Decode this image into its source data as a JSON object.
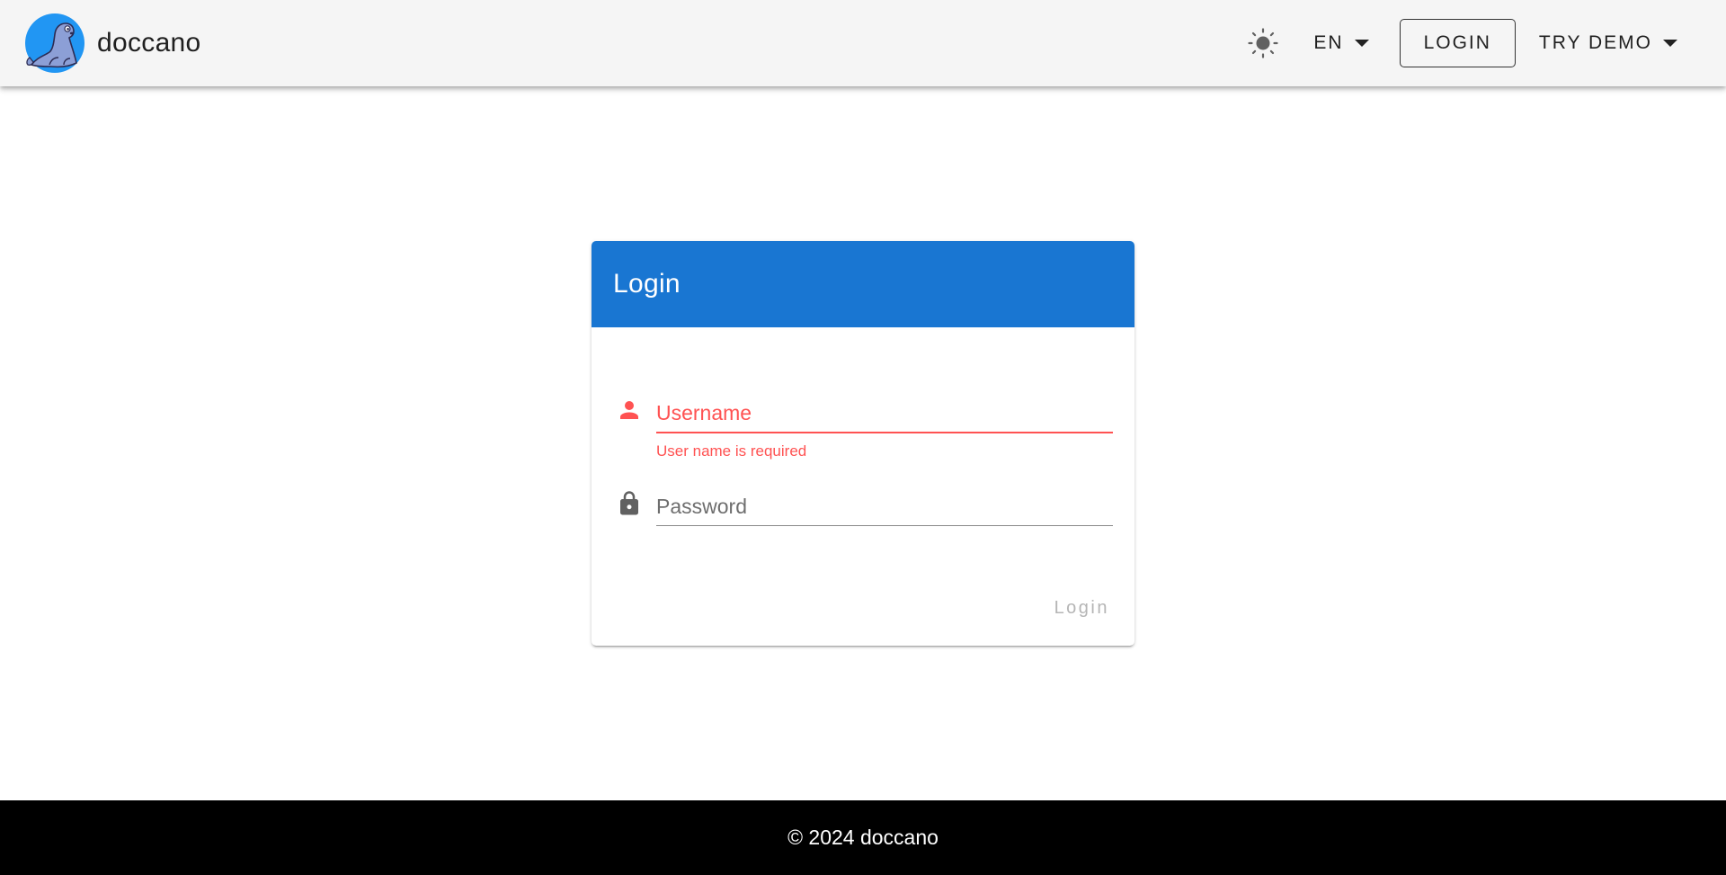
{
  "app": {
    "name": "doccano",
    "logo_icon": "seal-logo-icon",
    "accent_color": "#1976d2"
  },
  "toolbar": {
    "theme_icon": "sun-brightness-icon",
    "language_label": "EN",
    "login_label": "LOGIN",
    "demo_label": "TRY DEMO"
  },
  "login_card": {
    "title": "Login",
    "username": {
      "placeholder": "Username",
      "value": "",
      "icon": "account-icon",
      "error": "User name is required",
      "error_color": "#ff5252"
    },
    "password": {
      "placeholder": "Password",
      "value": "",
      "icon": "lock-icon"
    },
    "submit_label": "Login"
  },
  "footer": {
    "text": "© 2024 doccano"
  }
}
